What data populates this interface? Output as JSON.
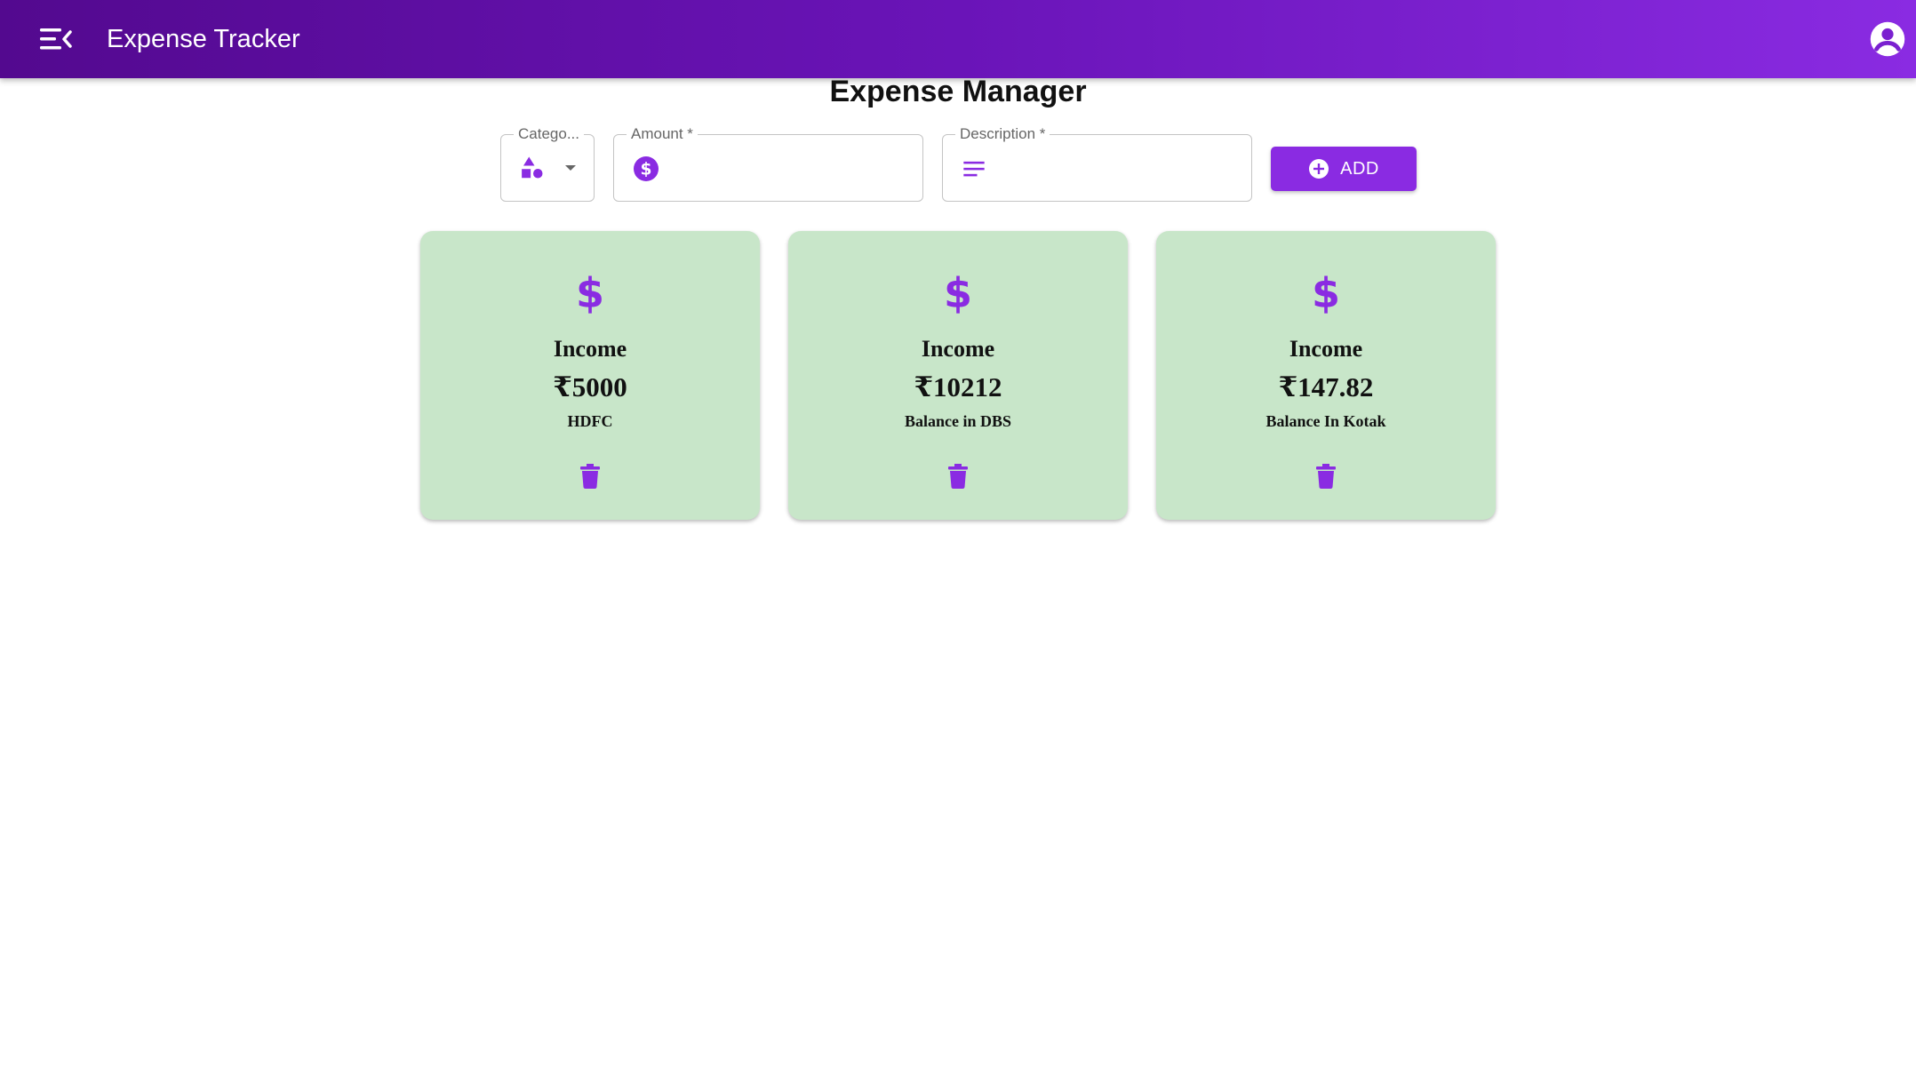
{
  "appbar": {
    "title": "Expense Tracker",
    "menu_icon": "menu-open-icon",
    "account_icon": "account-circle-icon"
  },
  "page": {
    "title": "Expense Manager"
  },
  "form": {
    "category": {
      "label": "Catego...",
      "icon": "category-shapes-icon",
      "value": ""
    },
    "amount": {
      "label": "Amount *",
      "icon": "dollar-circle-icon",
      "value": ""
    },
    "description": {
      "label": "Description *",
      "icon": "notes-lines-icon",
      "value": ""
    },
    "add_button": {
      "label": "ADD",
      "icon": "add-circle-icon"
    }
  },
  "cards": [
    {
      "type": "Income",
      "amount": "₹5000",
      "description": "HDFC",
      "icon": "dollar-icon"
    },
    {
      "type": "Income",
      "amount": "₹10212",
      "description": "Balance in DBS",
      "icon": "dollar-icon"
    },
    {
      "type": "Income",
      "amount": "₹147.82",
      "description": "Balance In Kotak",
      "icon": "dollar-icon"
    }
  ],
  "colors": {
    "accent": "#8a2be2",
    "appbar_start": "#53098f",
    "appbar_end": "#8a2be2",
    "card_bg": "#c8e6c9"
  }
}
